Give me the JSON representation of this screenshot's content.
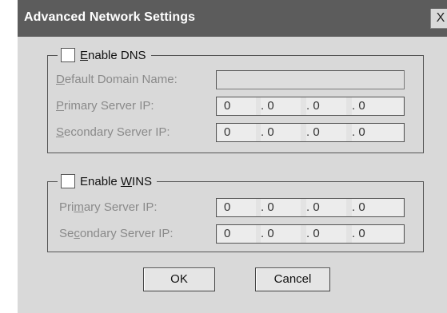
{
  "dialog": {
    "title": "Advanced Network Settings",
    "close_label": "X"
  },
  "dns": {
    "enable_label_pre": "",
    "enable_label_u": "E",
    "enable_label_post": "nable DNS",
    "checked": false,
    "default_domain": {
      "u": "D",
      "rest": "efault Domain Name:",
      "value": ""
    },
    "primary": {
      "u": "P",
      "rest": "rimary Server IP:",
      "octets": [
        "0",
        ". 0",
        ". 0",
        ". 0"
      ]
    },
    "secondary": {
      "u": "S",
      "rest": "econdary Server IP:",
      "octets": [
        "0",
        ". 0",
        ". 0",
        ". 0"
      ]
    }
  },
  "wins": {
    "enable_label_pre": "Enable ",
    "enable_label_u": "W",
    "enable_label_post": "INS",
    "checked": false,
    "primary": {
      "pre": "Pri",
      "u": "m",
      "rest": "ary Server IP:",
      "octets": [
        "0",
        ". 0",
        ". 0",
        ". 0"
      ]
    },
    "secondary": {
      "pre": "Se",
      "u": "c",
      "rest": "ondary Server IP:",
      "octets": [
        "0",
        ". 0",
        ". 0",
        ". 0"
      ]
    }
  },
  "buttons": {
    "ok": "OK",
    "cancel": "Cancel"
  }
}
